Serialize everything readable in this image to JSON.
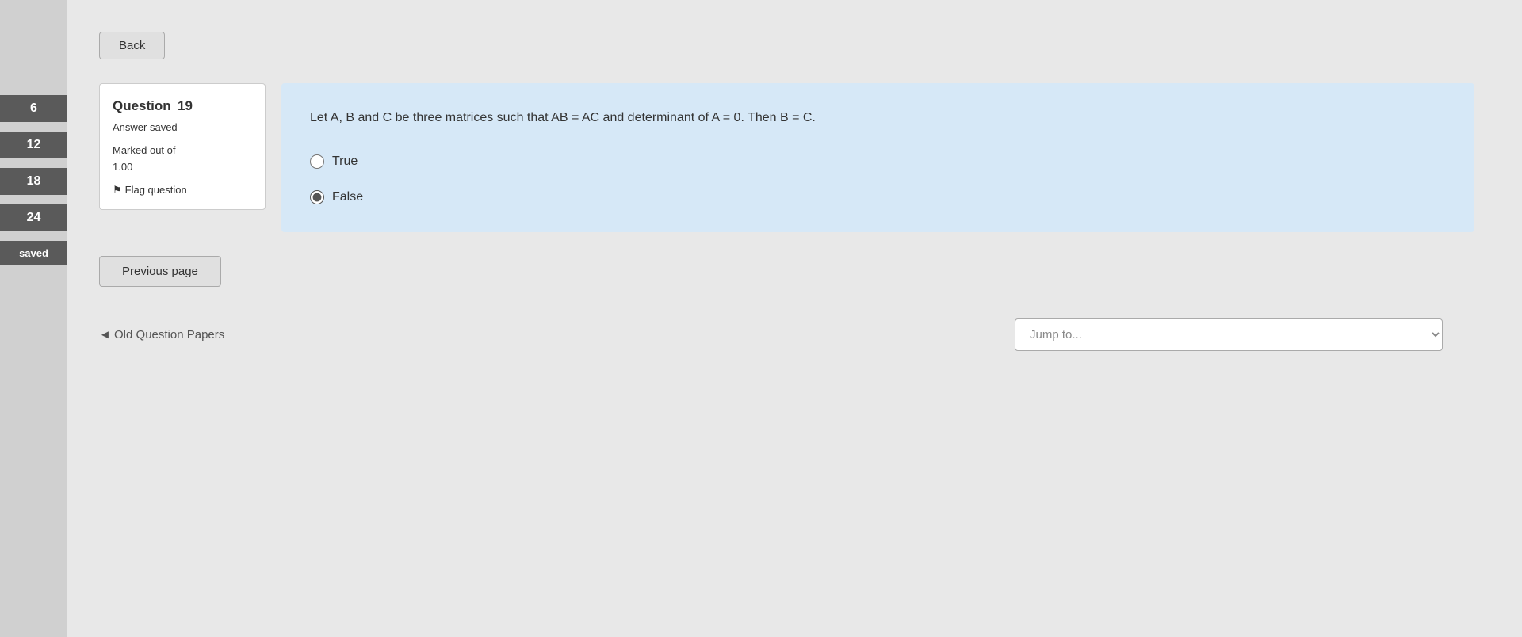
{
  "sidebar": {
    "items": [
      {
        "label": "6"
      },
      {
        "label": "12"
      },
      {
        "label": "18"
      },
      {
        "label": "24"
      }
    ],
    "saved_label": "saved"
  },
  "toolbar": {
    "back_label": "Back"
  },
  "question": {
    "number_label": "Question",
    "number": "19",
    "answer_saved": "Answer saved",
    "marked_out_label": "Marked out of",
    "marked_out_value": "1.00",
    "flag_label": "Flag question",
    "text": "Let A, B and C be three matrices such that AB = AC and determinant of A = 0. Then B = C.",
    "options": [
      {
        "label": "True",
        "value": "true",
        "selected": false
      },
      {
        "label": "False",
        "value": "false",
        "selected": true
      }
    ]
  },
  "navigation": {
    "previous_page_label": "Previous page"
  },
  "footer": {
    "old_question_papers_label": "◄ Old Question Papers",
    "jump_to_placeholder": "Jump to..."
  }
}
